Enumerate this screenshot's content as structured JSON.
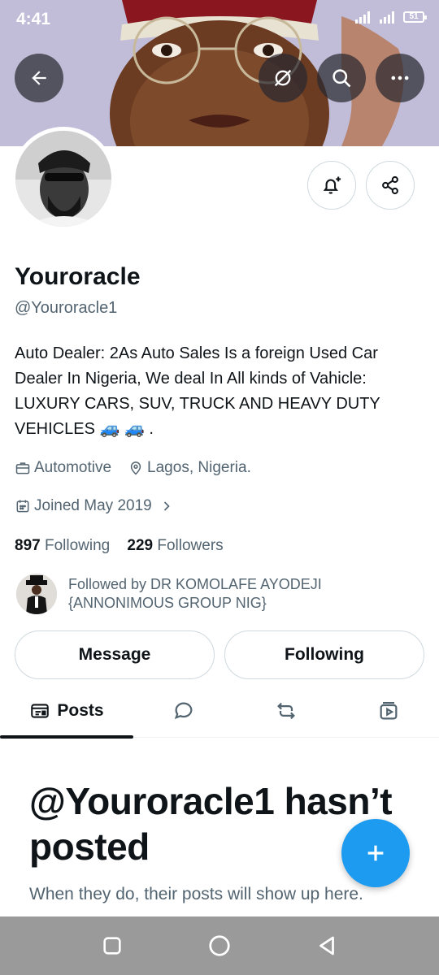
{
  "status_bar": {
    "time": "4:41",
    "network": "3G",
    "battery": "51"
  },
  "profile": {
    "name": "Youroracle",
    "handle": "@Youroracle1",
    "bio": "Auto Dealer: 2As Auto Sales Is a foreign Used Car Dealer In Nigeria, We deal In All kinds of Vahicle: LUXURY CARS, SUV, TRUCK AND HEAVY DUTY VEHICLES 🚙 🚙 .",
    "category": "Automotive",
    "location": "Lagos, Nigeria.",
    "joined": "Joined May 2019",
    "following_count": "897",
    "following_label": "Following",
    "followers_count": "229",
    "followers_label": "Followers",
    "followed_by": "Followed by DR KOMOLAFE AYODEJI {ANNONIMOUS GROUP NIG}"
  },
  "actions": {
    "message_label": "Message",
    "following_label": "Following"
  },
  "tabs": {
    "posts_label": "Posts"
  },
  "empty_state": {
    "title": "@Youroracle1 hasn’t posted",
    "subtitle": "When they do, their posts will show up here."
  },
  "colors": {
    "accent": "#1d9bf0",
    "text": "#0f1419",
    "secondary": "#536471",
    "border": "#cfd9de"
  },
  "icons": [
    "back-arrow-icon",
    "translate-off-icon",
    "search-icon",
    "more-icon",
    "bell-plus-icon",
    "share-icon",
    "briefcase-icon",
    "location-pin-icon",
    "calendar-icon",
    "chevron-right-icon",
    "posts-icon",
    "reply-icon",
    "repost-icon",
    "media-icon",
    "plus-icon",
    "recents-icon",
    "home-icon",
    "nav-back-icon"
  ]
}
